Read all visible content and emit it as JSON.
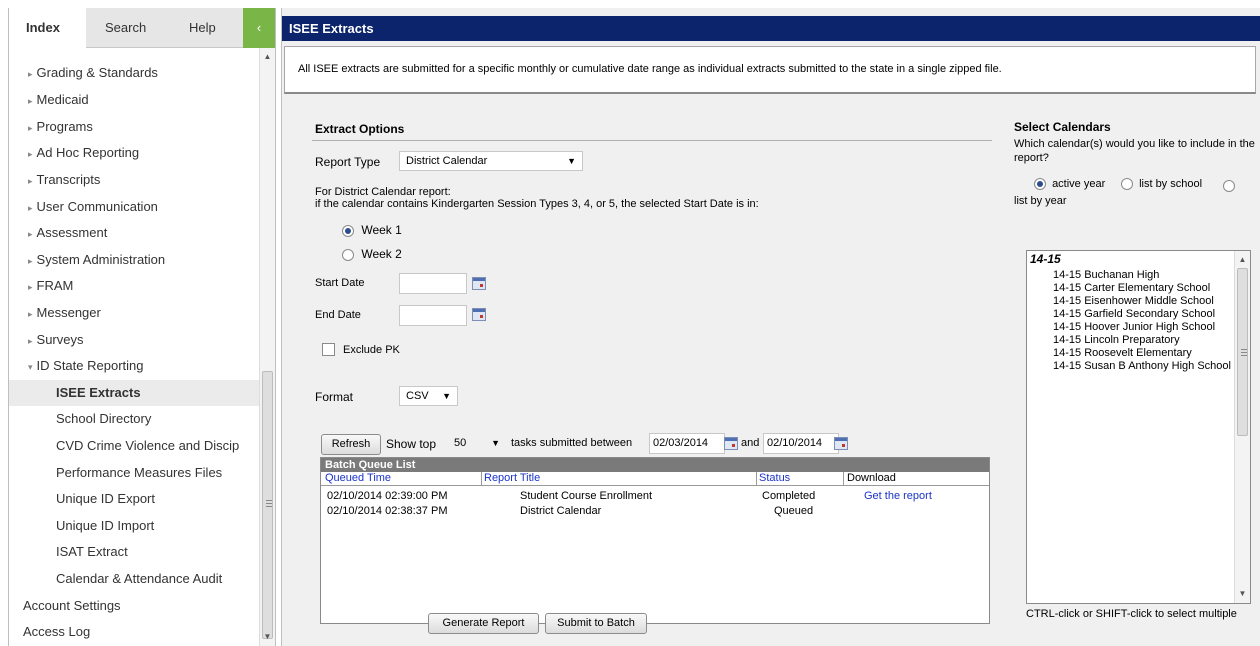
{
  "nav": {
    "tabs": [
      "Index",
      "Search",
      "Help"
    ],
    "collapse_glyph": "‹",
    "items": [
      {
        "label": "Grading & Standards",
        "expand": "▸"
      },
      {
        "label": "Medicaid",
        "expand": "▸"
      },
      {
        "label": "Programs",
        "expand": "▸"
      },
      {
        "label": "Ad Hoc Reporting",
        "expand": "▸"
      },
      {
        "label": "Transcripts",
        "expand": "▸"
      },
      {
        "label": "User Communication",
        "expand": "▸"
      },
      {
        "label": "Assessment",
        "expand": "▸"
      },
      {
        "label": "System Administration",
        "expand": "▸"
      },
      {
        "label": "FRAM",
        "expand": "▸"
      },
      {
        "label": "Messenger",
        "expand": "▸"
      },
      {
        "label": "Surveys",
        "expand": "▸"
      },
      {
        "label": "ID State Reporting",
        "expand": "▾"
      }
    ],
    "subitems": [
      {
        "label": "ISEE Extracts",
        "selected": true
      },
      {
        "label": "School Directory"
      },
      {
        "label": "CVD Crime Violence and Discip"
      },
      {
        "label": "Performance Measures Files"
      },
      {
        "label": "Unique ID Export"
      },
      {
        "label": "Unique ID Import"
      },
      {
        "label": "ISAT Extract"
      },
      {
        "label": "Calendar & Attendance Audit"
      }
    ],
    "bottom_items": [
      "Account Settings",
      "Access Log"
    ]
  },
  "page": {
    "title": "ISEE Extracts",
    "info": "All ISEE extracts are submitted for a specific monthly or cumulative date range as individual extracts submitted to the state in a single zipped file."
  },
  "extract_options": {
    "heading": "Extract Options",
    "report_type_label": "Report Type",
    "report_type_value": "District Calendar",
    "note_line1": "For District Calendar report:",
    "note_line2": "if the calendar contains Kindergarten Session Types 3, 4, or 5, the selected Start Date is in:",
    "week_options": [
      {
        "label": "Week 1",
        "checked": true
      },
      {
        "label": "Week 2",
        "checked": false
      }
    ],
    "start_date_label": "Start Date",
    "start_date_value": "",
    "end_date_label": "End Date",
    "end_date_value": "",
    "exclude_pk_label": "Exclude PK",
    "exclude_pk_checked": false,
    "format_label": "Format",
    "format_value": "CSV"
  },
  "batch": {
    "refresh_label": "Refresh",
    "show_top_label": "Show top",
    "show_top_value": "50",
    "tasks_between_label": "tasks submitted between",
    "from_date": "02/03/2014",
    "and_label": "and",
    "to_date": "02/10/2014",
    "list_title": "Batch Queue List",
    "columns": [
      "Queued Time",
      "Report Title",
      "Status",
      "Download"
    ],
    "rows": [
      {
        "queued_time": "02/10/2014 02:39:00 PM",
        "report_title": "Student Course Enrollment",
        "status": "Completed",
        "download": "Get the report"
      },
      {
        "queued_time": "02/10/2014 02:38:37 PM",
        "report_title": "District Calendar",
        "status": "Queued",
        "download": ""
      }
    ]
  },
  "buttons": {
    "generate": "Generate Report",
    "submit_batch": "Submit to Batch"
  },
  "select_calendars": {
    "heading": "Select Calendars",
    "question": "Which calendar(s) would you like to include in the report?",
    "options": [
      {
        "label": "active year",
        "checked": true
      },
      {
        "label": "list by school",
        "checked": false
      },
      {
        "label": "list by year",
        "checked": false
      }
    ],
    "year": "14-15",
    "schools": [
      "14-15 Buchanan High",
      "14-15 Carter Elementary School",
      "14-15 Eisenhower Middle School",
      "14-15 Garfield Secondary School",
      "14-15 Hoover Junior High School",
      "14-15 Lincoln Preparatory",
      "14-15 Roosevelt Elementary",
      "14-15 Susan B Anthony High School"
    ],
    "hint": "CTRL-click or SHIFT-click to select multiple"
  },
  "colors": {
    "title_bar": "#0c246c",
    "nav_collapse": "#7ab647",
    "link": "#1a33c8"
  }
}
